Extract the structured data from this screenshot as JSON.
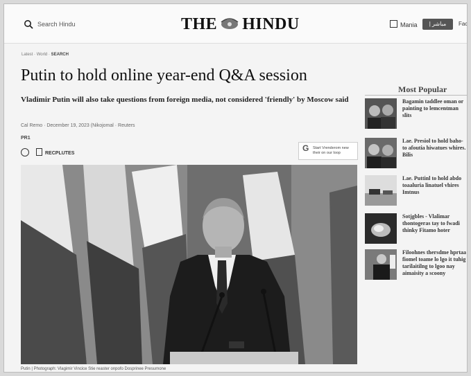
{
  "header": {
    "search_placeholder": "Search Hindu",
    "logo_left": "THE",
    "logo_right": "HINDU",
    "login_label": "Mania",
    "cta_label": "| مباشر",
    "extra_label": "Face"
  },
  "article": {
    "breadcrumb": [
      "Latest",
      "World",
      "SEARCH"
    ],
    "headline": "Putin to hold online year-end Q&A session",
    "standfirst": "Vladimir Putin will also take questions from foreign media, not considered 'friendly' by Moscow said",
    "byline": "Cal Remo · December 19, 2023 (Nikojomal · Reuters",
    "tag": "PR1",
    "share_label": "RECPLUTES",
    "google_text": "Start Vrenderom new their on our loop",
    "caption": "Putin | Photograph: Vlagimir Vincice Stie reaster onpofo Dosprinee Presumone"
  },
  "sidebar": {
    "title": "Most Popular",
    "items": [
      {
        "text": "Bagamin taddlee oman or painting to lemcentman slits",
        "thumb": "faces"
      },
      {
        "text": "Lae. Presiol to hold baho- to afoutia hiwatues whires. Bilis",
        "thumb": "faces"
      },
      {
        "text": "Lae. Puttinl to hold abdo toaaluria linatuel vhires Imtnus",
        "thumb": "vehicles"
      },
      {
        "text": "Sotjgbles - Vlalimar thontogeras tay to fwadi thinky Fitamo hoter",
        "thumb": "fire"
      },
      {
        "text": "Filoohnes thersdme hprtaa fiomel toame lo lgo it tuhig tarilaitilng to lgoo nay aimaisity a scoony",
        "thumb": "speaker"
      }
    ]
  }
}
